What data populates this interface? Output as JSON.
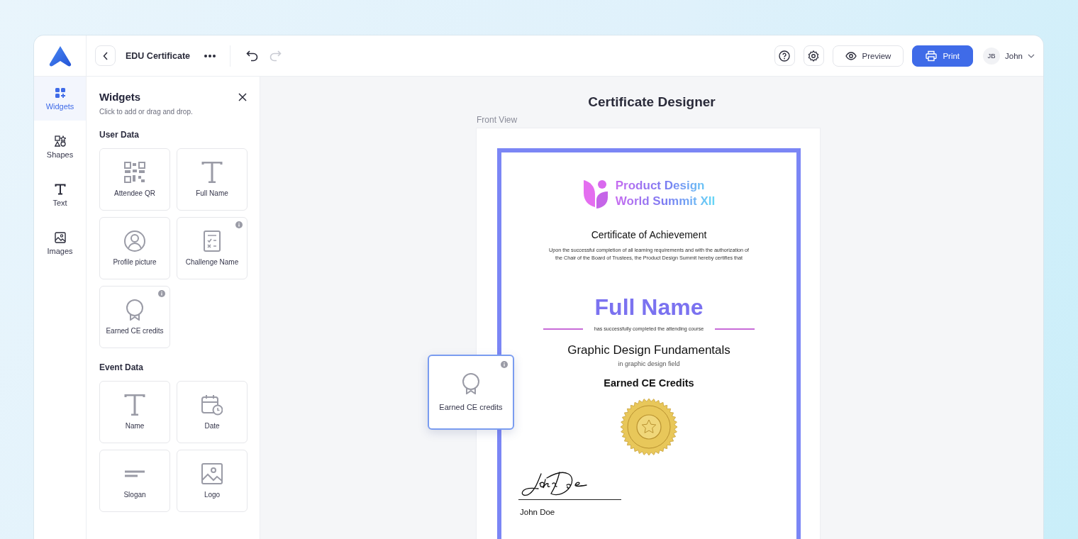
{
  "header": {
    "document_title": "EDU Certificate",
    "history": [
      {
        "kind": "undo",
        "disabled": false
      },
      {
        "kind": "redo",
        "disabled": true
      }
    ],
    "actions": [
      {
        "kind": "help"
      },
      {
        "kind": "settings"
      },
      {
        "kind": "preview",
        "label": "Preview",
        "primary": false
      },
      {
        "kind": "print",
        "label": "Print",
        "primary": true
      }
    ],
    "user": {
      "initials": "JB",
      "name": "John"
    }
  },
  "sidebar": {
    "items": [
      {
        "kind": "widgets",
        "label": "Widgets",
        "selected": true
      },
      {
        "kind": "shapes",
        "label": "Shapes",
        "selected": false
      },
      {
        "kind": "text",
        "label": "Text",
        "selected": false
      },
      {
        "kind": "images",
        "label": "Images",
        "selected": false
      }
    ]
  },
  "panel": {
    "title": "Widgets",
    "subtitle": "Click to add or drag and drop.",
    "sections": [
      {
        "heading": "User Data",
        "widgets": [
          {
            "kind": "qr",
            "label": "Attendee QR",
            "info": false
          },
          {
            "kind": "text",
            "label": "Full Name",
            "info": false
          },
          {
            "kind": "profile",
            "label": "Profile picture",
            "info": false
          },
          {
            "kind": "checklist",
            "label": "Challenge Name",
            "info": true
          },
          {
            "kind": "award",
            "label": "Earned CE credits",
            "info": true
          }
        ]
      },
      {
        "heading": "Event Data",
        "widgets": [
          {
            "kind": "text",
            "label": "Name",
            "info": false
          },
          {
            "kind": "calendar",
            "label": "Date",
            "info": false
          },
          {
            "kind": "slogan",
            "label": "Slogan",
            "info": false
          },
          {
            "kind": "image",
            "label": "Logo",
            "info": false
          }
        ]
      }
    ]
  },
  "canvas": {
    "title": "Certificate Designer",
    "view_label": "Front View",
    "certificate": {
      "logo_line_1": "Product Design",
      "logo_line_2": "World Summit XII",
      "heading": "Certificate of Achievement",
      "intro": "Upon the successful completion of all learning requirements and with the authorization of\nthe Chair of the Board of Trustees, the Product Design Summit hereby certifies that",
      "recipient": "Full Name",
      "completion_text": "has successfully completed the attending course",
      "course": "Graphic Design Fundamentals",
      "field": "in graphic design field",
      "credits_heading": "Earned CE Credits",
      "signer": "John Doe"
    },
    "dragged_widget": {
      "kind": "award",
      "label": "Earned CE credits",
      "info": true
    }
  }
}
